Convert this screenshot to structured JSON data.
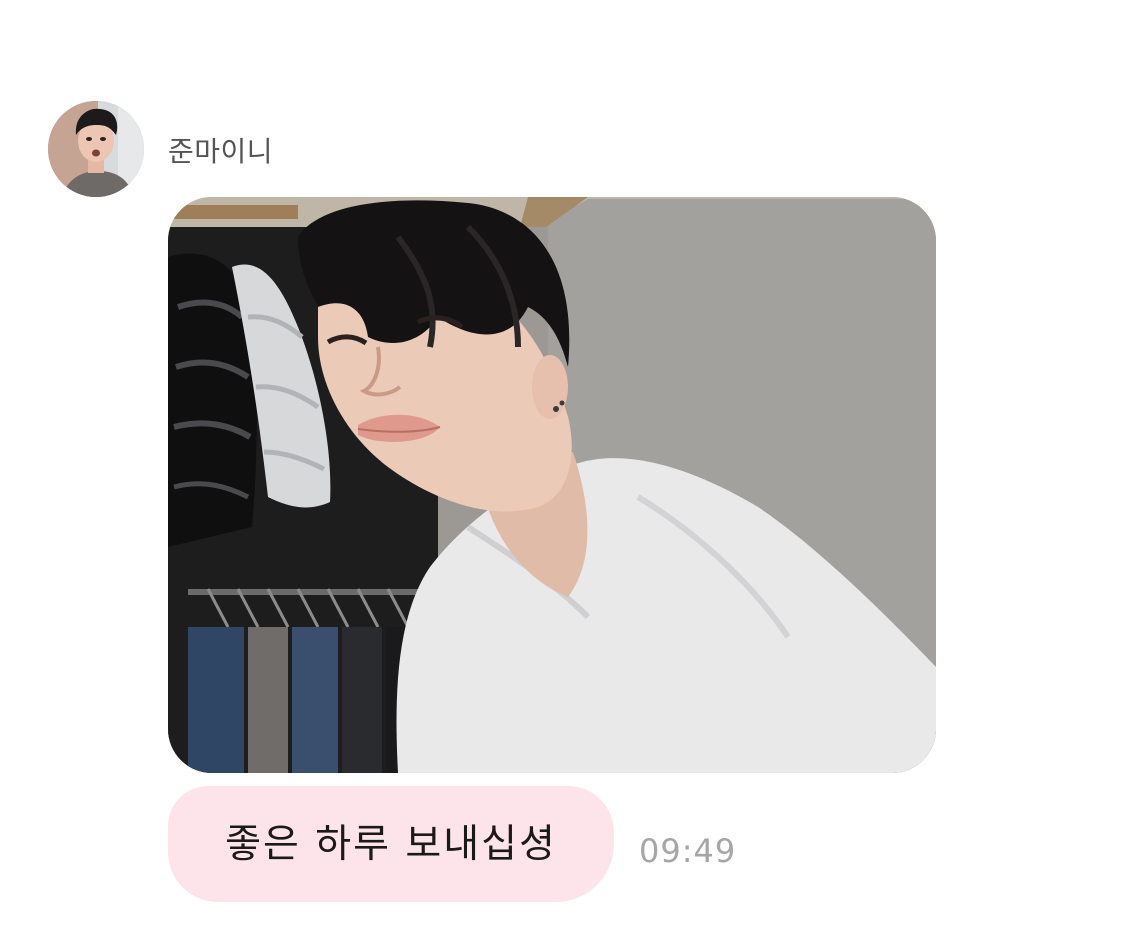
{
  "message": {
    "sender": {
      "name": "준마이니",
      "avatar_icon": "profile-photo"
    },
    "photo": {
      "content": "selfie-photo"
    },
    "text": "좋은 하루 보내십셩",
    "time": "09:49"
  },
  "colors": {
    "bubble_background": "#fde4ea",
    "timestamp_text": "#a6a6a6",
    "name_text": "#555555",
    "message_text": "#1a1a1a"
  }
}
